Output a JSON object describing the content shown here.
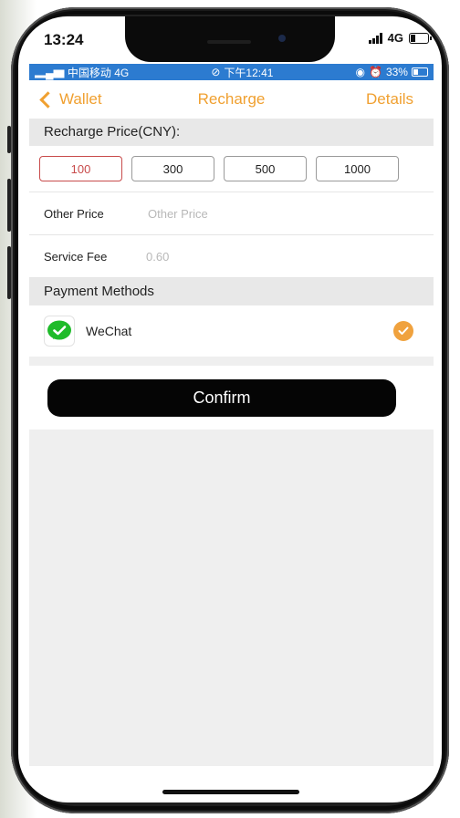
{
  "device": {
    "time": "13:24",
    "network": "4G"
  },
  "inner_status": {
    "carrier": "中国移动",
    "network": "4G",
    "time": "下午12:41",
    "battery": "33%"
  },
  "nav": {
    "back_label": "Wallet",
    "title": "Recharge",
    "right_label": "Details",
    "accent_color": "#f0a030"
  },
  "recharge": {
    "header": "Recharge Price(CNY):",
    "options": [
      "100",
      "300",
      "500",
      "1000"
    ],
    "selected": "100"
  },
  "other_price": {
    "label": "Other Price",
    "placeholder": "Other Price"
  },
  "service_fee": {
    "label": "Service Fee",
    "value": "0.60"
  },
  "payment": {
    "header": "Payment Methods",
    "method_name": "WeChat",
    "icon": "wechat-icon",
    "selected_icon": "check-circle-icon"
  },
  "confirm_label": "Confirm"
}
